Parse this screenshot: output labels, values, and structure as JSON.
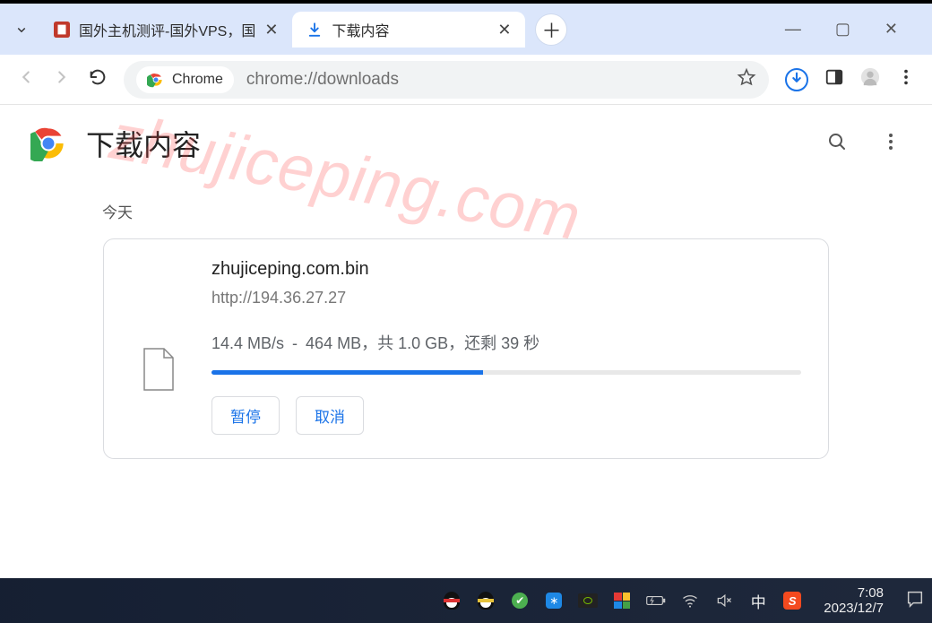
{
  "tabs": {
    "inactive": {
      "title": "国外主机测评-国外VPS，国"
    },
    "active": {
      "title": "下载内容"
    }
  },
  "address": {
    "chip_label": "Chrome",
    "url": "chrome://downloads"
  },
  "page": {
    "title": "下载内容",
    "section_today": "今天"
  },
  "download": {
    "filename": "zhujiceping.com.bin",
    "source_url": "http://194.36.27.27",
    "speed": "14.4 MB/s",
    "downloaded": "464 MB",
    "total": "1.0 GB",
    "remaining_label": "还剩",
    "remaining_value": "39 秒",
    "total_label": "共",
    "progress_percent": 46,
    "btn_pause": "暂停",
    "btn_cancel": "取消"
  },
  "watermark": "zhujiceping.com",
  "taskbar": {
    "ime": "中",
    "time": "7:08",
    "date": "2023/12/7"
  }
}
